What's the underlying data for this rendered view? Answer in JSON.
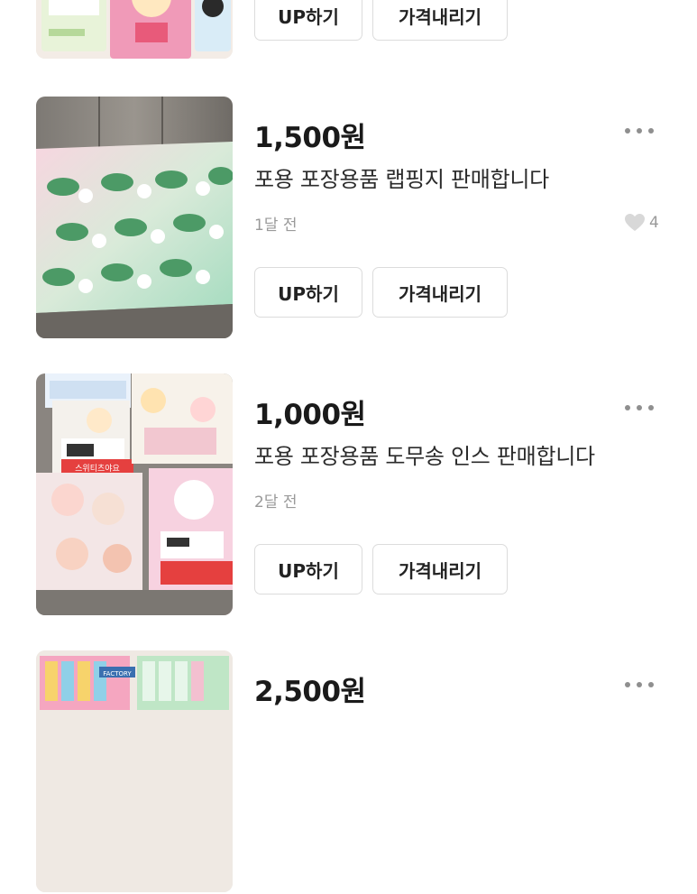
{
  "buttons": {
    "up_label": "UP하기",
    "price_down_label": "가격내리기"
  },
  "items": [
    {
      "price": "",
      "title": "",
      "time": "",
      "likes": ""
    },
    {
      "price": "1,500원",
      "title": "포용 포장용품 랩핑지 판매합니다",
      "time": "1달 전",
      "likes": "4"
    },
    {
      "price": "1,000원",
      "title": "포용 포장용품 도무송 인스 판매합니다",
      "time": "2달 전",
      "likes": ""
    },
    {
      "price": "2,500원",
      "title": "",
      "time": "",
      "likes": ""
    }
  ],
  "thumbnail_labels": {
    "sticker_tag": "스위티츠야요",
    "factory_sign": "FACTORY"
  },
  "colors": {
    "wrap_pink": "#f2c4d4",
    "wrap_green": "#9fd4b0",
    "tag_red": "#e5403f",
    "icon_gray": "#8f8f8f"
  },
  "icons": {
    "more": "three-dots-horizontal",
    "like": "heart-outline"
  }
}
